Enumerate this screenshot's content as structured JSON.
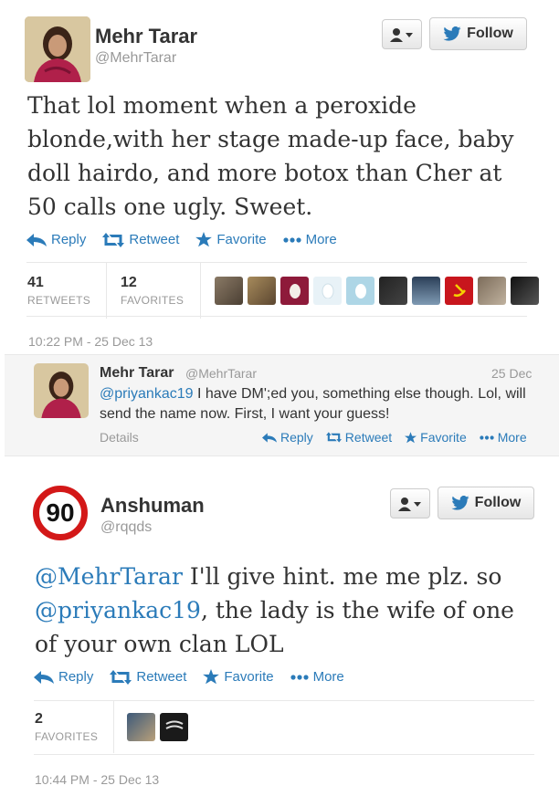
{
  "tweet1": {
    "name": "Mehr Tarar",
    "handle": "@MehrTarar",
    "follow_label": "Follow",
    "text": "That lol moment when a peroxide blonde,with her stage made-up face, baby doll hairdo, and more botox than Cher at 50 calls one ugly. Sweet.",
    "actions": {
      "reply": "Reply",
      "retweet": "Retweet",
      "favorite": "Favorite",
      "more": "More"
    },
    "stats": {
      "retweets_count": "41",
      "retweets_label": "RETWEETS",
      "favorites_count": "12",
      "favorites_label": "FAVORITES"
    },
    "timestamp": "10:22 PM - 25 Dec 13"
  },
  "reply": {
    "name": "Mehr Tarar",
    "handle": "@MehrTarar",
    "date": "25 Dec",
    "mention": "@priyankac19",
    "text_rest": " I have DM';ed you, something else though. Lol, will send the name now. First, I want your guess!",
    "details": "Details",
    "actions": {
      "reply": "Reply",
      "retweet": "Retweet",
      "favorite": "Favorite",
      "more": "More"
    }
  },
  "tweet2": {
    "name": "Anshuman",
    "handle": "@rqqds",
    "avatar_text": "90",
    "follow_label": "Follow",
    "mention1": "@MehrTarar",
    "text_part1": " I'll give hint. me me plz. so ",
    "mention2": "@priyankac19",
    "text_part2": ", the lady is the wife of one of your own clan LOL",
    "actions": {
      "reply": "Reply",
      "retweet": "Retweet",
      "favorite": "Favorite",
      "more": "More"
    },
    "stats": {
      "favorites_count": "2",
      "favorites_label": "FAVORITES"
    },
    "timestamp": "10:44 PM - 25 Dec 13"
  },
  "colors": {
    "link": "#2B7BB9",
    "muted": "#999999",
    "text": "#333333",
    "badge_red": "#d31818"
  }
}
